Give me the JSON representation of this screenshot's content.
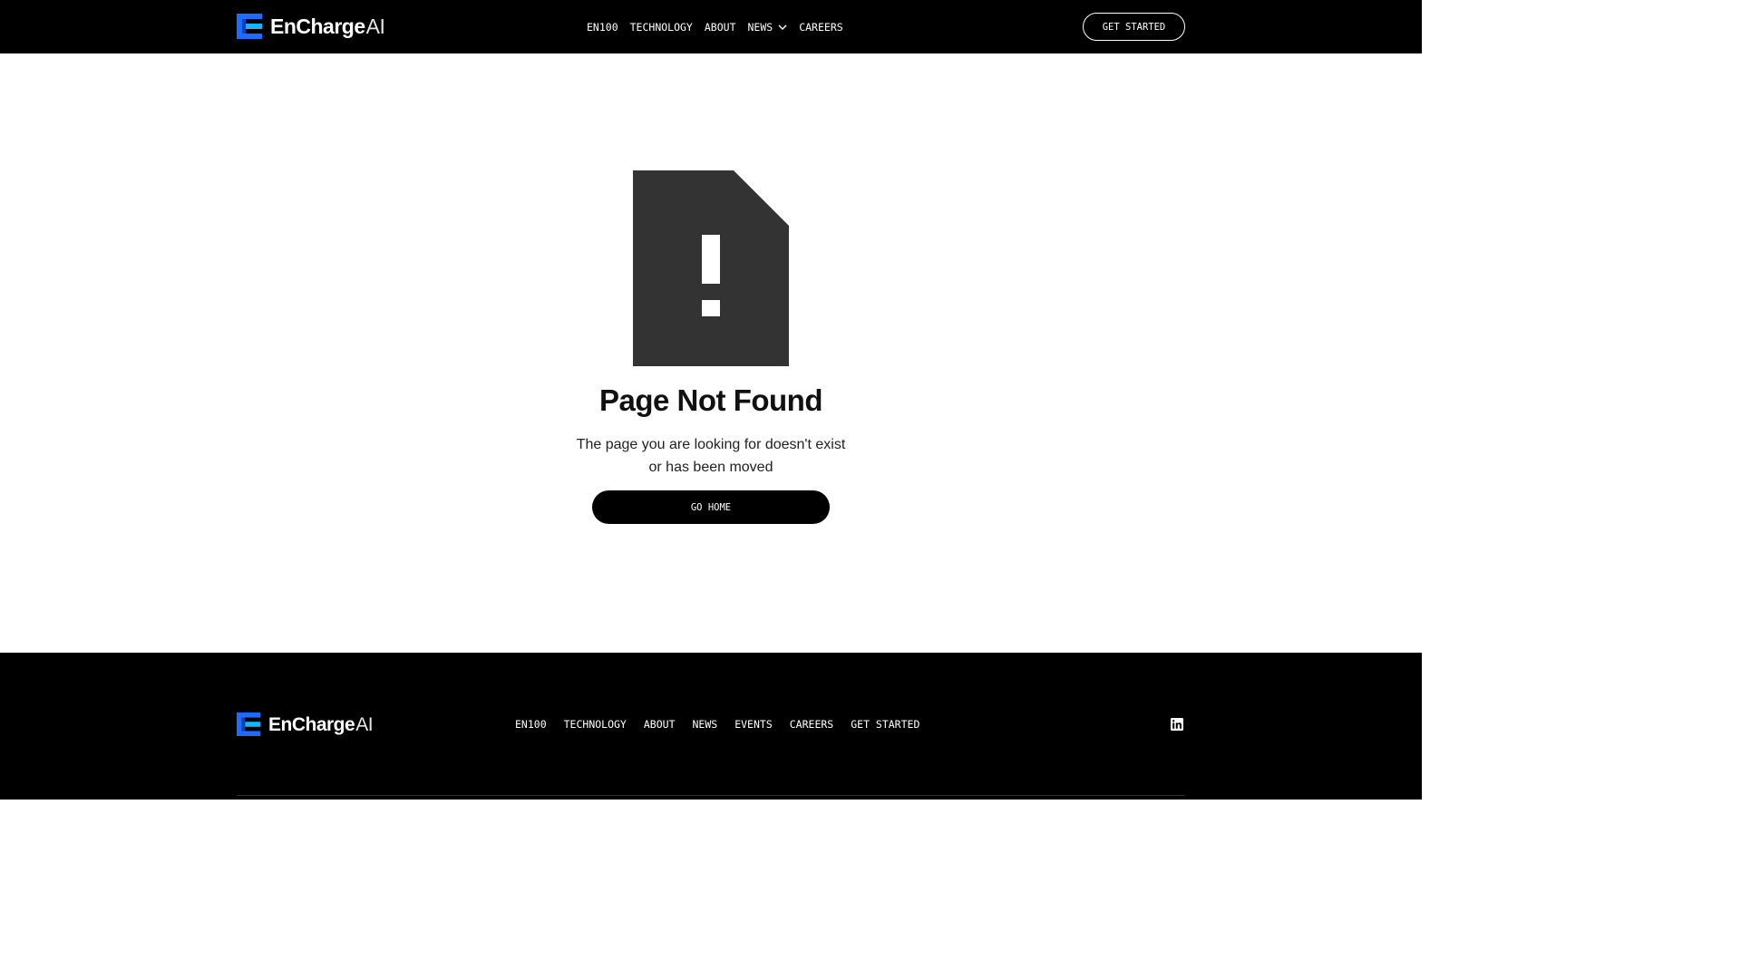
{
  "brand": {
    "name": "EnCharge",
    "suffix": "AI",
    "logo_icon": "encharge-logo-icon",
    "colors": {
      "blue": "#1e6bff",
      "cyan": "#18b4f5",
      "dark": "#000000"
    }
  },
  "header": {
    "nav": [
      {
        "label": "EN100"
      },
      {
        "label": "TECHNOLOGY"
      },
      {
        "label": "ABOUT"
      },
      {
        "label": "NEWS",
        "has_dropdown": true
      },
      {
        "label": "CAREERS"
      }
    ],
    "cta_label": "GET STARTED"
  },
  "error": {
    "icon": "file-alert-icon",
    "title": "Page Not Found",
    "message": "The page you are looking for doesn't exist or has been moved",
    "button_label": "GO HOME"
  },
  "footer": {
    "nav": [
      {
        "label": "EN100"
      },
      {
        "label": "TECHNOLOGY"
      },
      {
        "label": "ABOUT"
      },
      {
        "label": "NEWS"
      },
      {
        "label": "EVENTS"
      },
      {
        "label": "CAREERS"
      },
      {
        "label": "GET STARTED"
      }
    ],
    "social_icon": "linkedin-icon"
  }
}
